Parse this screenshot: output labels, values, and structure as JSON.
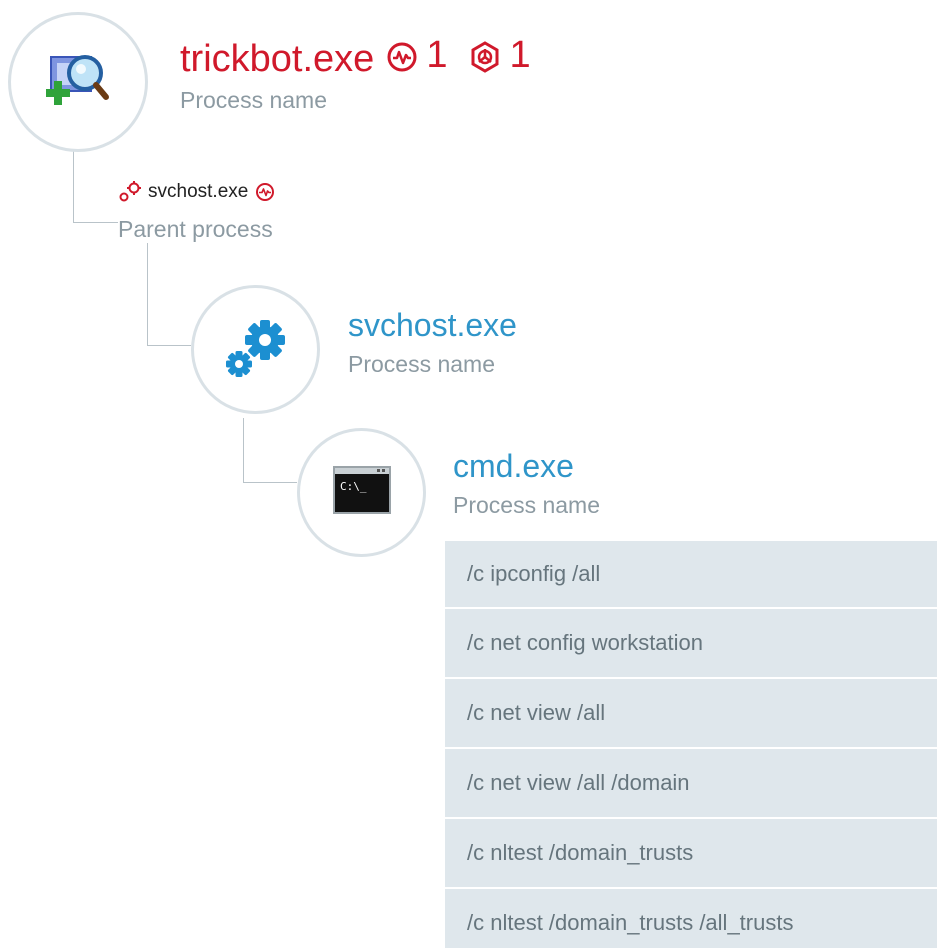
{
  "root": {
    "name": "trickbot.exe",
    "subtitle": "Process name",
    "behavior_count": "1",
    "threat_count": "1",
    "icon": "process-explorer-icon",
    "accent_color": "#d0192b"
  },
  "parent": {
    "name": "svchost.exe",
    "subtitle": "Parent process",
    "icon": "gears-icon"
  },
  "svchost": {
    "name": "svchost.exe",
    "subtitle": "Process name",
    "icon": "gears-icon",
    "accent_color": "#2f95c9"
  },
  "cmd": {
    "name": "cmd.exe",
    "subtitle": "Process name",
    "icon": "command-prompt-icon",
    "prompt_text": "C:\\_",
    "accent_color": "#2f95c9"
  },
  "commands": [
    "/c ipconfig /all",
    "/c net config workstation",
    "/c net view /all",
    "/c net view /all /domain",
    "/c nltest /domain_trusts",
    "/c nltest /domain_trusts /all_trusts"
  ]
}
